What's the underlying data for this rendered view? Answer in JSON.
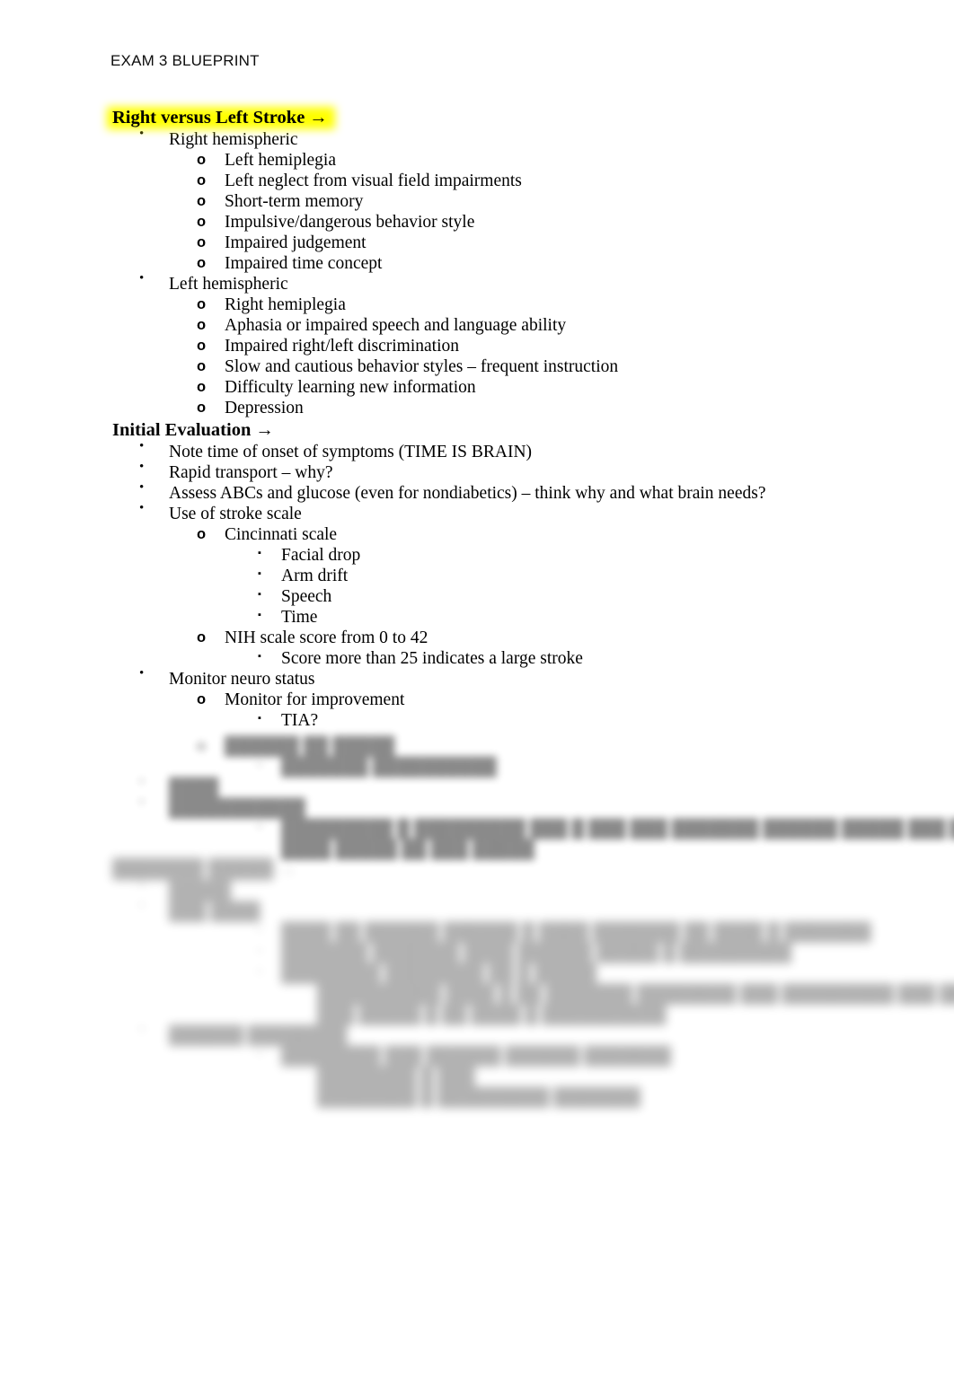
{
  "document": {
    "running_header": "EXAM 3 BLUEPRINT"
  },
  "sections": [
    {
      "heading": "Right versus Left Stroke →",
      "highlighted": true,
      "items": [
        {
          "level": 1,
          "text": "Right hemispheric"
        },
        {
          "level": 2,
          "text": "Left hemiplegia"
        },
        {
          "level": 2,
          "text": "Left neglect from visual field impairments"
        },
        {
          "level": 2,
          "text": "Short-term memory"
        },
        {
          "level": 2,
          "text": "Impulsive/dangerous behavior style"
        },
        {
          "level": 2,
          "text": "Impaired judgement"
        },
        {
          "level": 2,
          "text": "Impaired time concept"
        },
        {
          "level": 1,
          "text": "Left hemispheric"
        },
        {
          "level": 2,
          "text": "Right hemiplegia"
        },
        {
          "level": 2,
          "text": "Aphasia or impaired speech and language ability"
        },
        {
          "level": 2,
          "text": "Impaired right/left discrimination"
        },
        {
          "level": 2,
          "text": "Slow and cautious behavior styles – frequent instruction"
        },
        {
          "level": 2,
          "text": "Difficulty learning new information"
        },
        {
          "level": 2,
          "text": "Depression"
        }
      ]
    },
    {
      "heading": "Initial Evaluation →",
      "highlighted": false,
      "items": [
        {
          "level": 1,
          "text": "Note time of onset of symptoms (TIME IS BRAIN)"
        },
        {
          "level": 1,
          "text": "Rapid transport – why?"
        },
        {
          "level": 1,
          "text": "Assess ABCs and glucose (even for nondiabetics) – think why and what brain needs?"
        },
        {
          "level": 1,
          "text": "Use of stroke scale"
        },
        {
          "level": 2,
          "text": "Cincinnati scale"
        },
        {
          "level": 3,
          "text": "Facial drop"
        },
        {
          "level": 3,
          "text": "Arm drift"
        },
        {
          "level": 3,
          "text": "Speech"
        },
        {
          "level": 3,
          "text": "Time"
        },
        {
          "level": 2,
          "text": "NIH scale score from 0 to 42"
        },
        {
          "level": 3,
          "text": "Score more than 25 indicates a large stroke"
        },
        {
          "level": 1,
          "text": "Monitor neuro status"
        },
        {
          "level": 2,
          "text": "Monitor for improvement"
        },
        {
          "level": 3,
          "text": "TIA?"
        }
      ]
    }
  ],
  "obscured_preview": {
    "note": "Remaining content is blurred out and not legible in the screenshot.",
    "blocks": [
      {
        "heading": null,
        "items": [
          {
            "level": 2,
            "text": "██████ ██ █████"
          },
          {
            "level": 3,
            "text": "███████ ██████████"
          },
          {
            "level": 1,
            "text": "████"
          },
          {
            "level": 1,
            "text": "███████████"
          },
          {
            "level": 3,
            "text": "█████████ █ █████████ ███ █ ███ ███ ███████ ██████ █████ ███ ████ ██ ███ █"
          },
          {
            "level": 3,
            "text": "████ █████ ██ ███ █████"
          }
        ]
      },
      {
        "heading": "███████ █████ →",
        "items": [
          {
            "level": 1,
            "text": "█████"
          },
          {
            "level": 1,
            "text": "███ ████"
          },
          {
            "level": 3,
            "text": "████ ██ ██████ ██████ █ ████ ███████ ██ ████ █ ███████"
          },
          {
            "level": 3,
            "text": "███████ ███████ ████ ██████ █████ █ █████████"
          },
          {
            "level": 3,
            "text": "████████ ████████ ██ █ █████"
          },
          {
            "level": 4,
            "text": "██████████ ████ █ ██ ███████ ████████ ███ █████████ ███ ████ ███ ███"
          },
          {
            "level": 4,
            "text": "███ █████ █ ██ ████ █ ██████████"
          },
          {
            "level": 1,
            "text": "██████ ████████"
          },
          {
            "level": 3,
            "text": "████████ ███ ██████ ██████ ███████"
          },
          {
            "level": 4,
            "text": "████████ █ ███"
          },
          {
            "level": 4,
            "text": "████████ █ █████████ ███████"
          }
        ]
      }
    ]
  },
  "glyphs": {
    "bullet_level1": "•",
    "bullet_level2": "o",
    "bullet_level3": "▪",
    "arrow": "→"
  },
  "colors": {
    "page_background": "#ffffff",
    "text": "#000000",
    "highlight_yellow": "#ffff00"
  }
}
